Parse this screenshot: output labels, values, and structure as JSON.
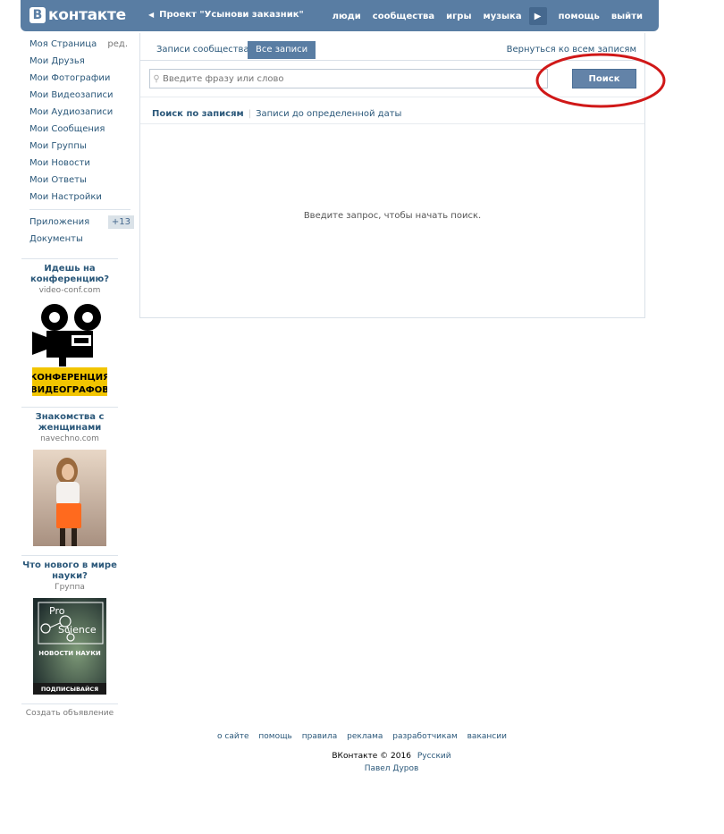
{
  "header": {
    "logo_letter": "В",
    "logo_text": "контакте",
    "back_label": "Проект \"Усынови заказник\"",
    "nav": [
      "люди",
      "сообщества",
      "игры",
      "музыка"
    ],
    "nav_after": [
      "помощь",
      "выйти"
    ]
  },
  "sidebar": {
    "items": [
      {
        "label": "Моя Страница",
        "extra": "ред."
      },
      {
        "label": "Мои Друзья"
      },
      {
        "label": "Мои Фотографии"
      },
      {
        "label": "Мои Видеозаписи"
      },
      {
        "label": "Мои Аудиозаписи"
      },
      {
        "label": "Мои Сообщения"
      },
      {
        "label": "Мои Группы"
      },
      {
        "label": "Мои Новости"
      },
      {
        "label": "Мои Ответы"
      },
      {
        "label": "Мои Настройки"
      }
    ],
    "apps_label": "Приложения",
    "apps_badge": "+13",
    "docs_label": "Документы",
    "ads": [
      {
        "title": "Идешь на конференцию?",
        "sub": "video-conf.com",
        "img_text_1": "КОНФЕРЕНЦИЯ",
        "img_text_2": "ВИДЕОГРАФОВ"
      },
      {
        "title": "Знакомства с женщинами",
        "sub": "navechno.com"
      },
      {
        "title": "Что нового в мире науки?",
        "sub": "Группа",
        "img_text_1": "Pro",
        "img_text_2": "Science",
        "img_text_3": "НОВОСТИ НАУКИ",
        "img_text_4": "ПОДПИСЫВАЙСЯ"
      }
    ],
    "create_ad": "Создать объявление"
  },
  "main": {
    "tabs": [
      {
        "label": "Записи сообщества",
        "active": false
      },
      {
        "label": "Все записи",
        "active": true
      }
    ],
    "back_to_all": "Вернуться ко всем записям",
    "search_placeholder": "Введите фразу или слово",
    "search_button": "Поиск",
    "subnav_active": "Поиск по записям",
    "subnav_link": "Записи до определенной даты",
    "empty_text": "Введите запрос, чтобы начать поиск."
  },
  "footer": {
    "links": [
      "о сайте",
      "помощь",
      "правила",
      "реклама",
      "разработчикам",
      "вакансии"
    ],
    "copyright": "ВКонтакте © 2016",
    "language": "Русский",
    "author": "Павел Дуров"
  },
  "colors": {
    "header_bg": "#597da3",
    "link": "#2B587A",
    "button": "#6383a8",
    "annotation": "#d01818"
  }
}
